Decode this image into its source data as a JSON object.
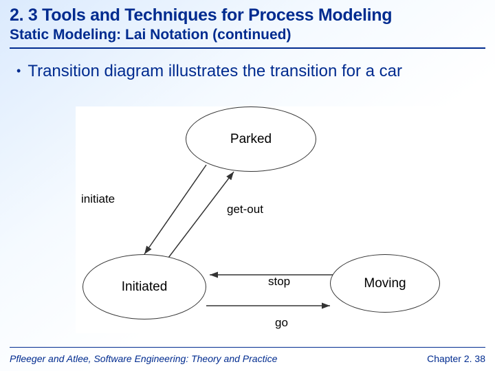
{
  "title": "2. 3 Tools and Techniques for Process Modeling",
  "subtitle": "Static Modeling: Lai Notation (continued)",
  "bullet": "Transition diagram illustrates the transition for a car",
  "diagram": {
    "states": {
      "parked": "Parked",
      "initiated": "Initiated",
      "moving": "Moving"
    },
    "transitions": {
      "initiate": "initiate",
      "getout": "get-out",
      "stop": "stop",
      "go": "go"
    }
  },
  "footer": {
    "left": "Pfleeger and Atlee, Software Engineering: Theory and Practice",
    "right": "Chapter 2. 38"
  }
}
